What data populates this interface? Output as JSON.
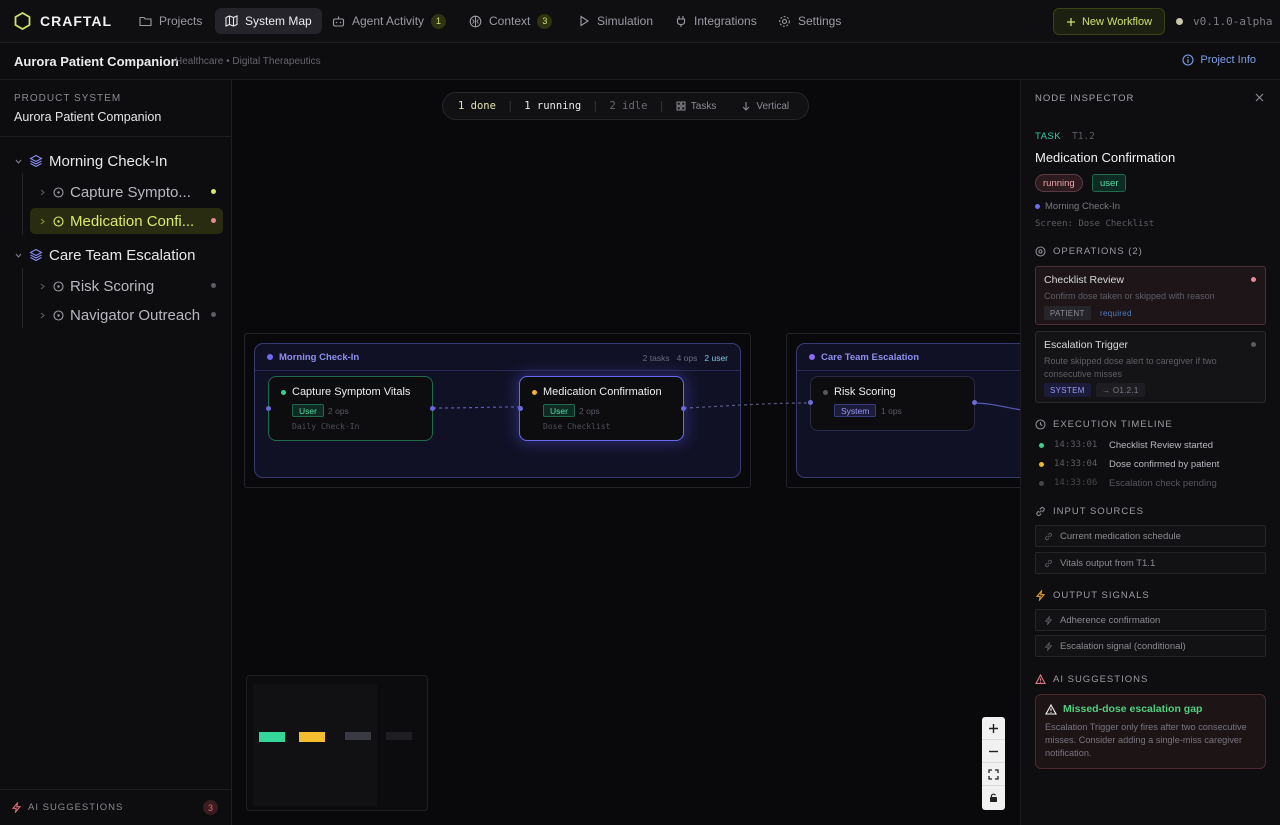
{
  "app": {
    "logo_text": "CRAFTAL",
    "version": "v0.1.0-alpha",
    "new_workflow_label": "New Workflow"
  },
  "nav": [
    {
      "label": "Projects",
      "icon": "folder-icon"
    },
    {
      "label": "System Map",
      "icon": "map-icon",
      "active": true
    },
    {
      "label": "Agent Activity",
      "icon": "robot-icon",
      "badge": "1"
    },
    {
      "label": "Context",
      "icon": "brain-icon",
      "badge": "3"
    },
    {
      "label": "Simulation",
      "icon": "play-icon"
    },
    {
      "label": "Integrations",
      "icon": "plug-icon"
    },
    {
      "label": "Settings",
      "icon": "gear-icon"
    }
  ],
  "project": {
    "title": "Aurora Patient Companion",
    "meta": "Healthcare • Digital Therapeutics",
    "info_label": "Project Info"
  },
  "sidebar": {
    "label": "PRODUCT SYSTEM",
    "system_name": "Aurora Patient Companion",
    "groups": [
      {
        "label": "Morning Check-In",
        "tasks": [
          {
            "label": "Capture Sympto...",
            "status_color": "#d9e870"
          },
          {
            "label": "Medication Confi...",
            "status_color": "#e58a96",
            "selected": true
          }
        ]
      },
      {
        "label": "Care Team Escalation",
        "tasks": [
          {
            "label": "Risk Scoring",
            "status_color": "#5c5c64"
          },
          {
            "label": "Navigator Outreach",
            "status_color": "#5c5c64"
          }
        ]
      }
    ],
    "bottom_label": "AI SUGGESTIONS",
    "bottom_count": "3"
  },
  "canvas": {
    "status": {
      "done": "1 done",
      "running": "1 running",
      "idle": "2 idle"
    },
    "tasks_label": "Tasks",
    "layout_label": "Vertical",
    "groups": [
      {
        "title": "Morning Check-In",
        "tasks": "2 tasks",
        "ops": "4 ops",
        "users": "2 user"
      },
      {
        "title": "Care Team Escalation"
      }
    ],
    "nodes": [
      {
        "title": "Capture Symptom Vitals",
        "tag": "User",
        "ops": "2 ops",
        "screen": "Daily Check-In",
        "dot": "#3ecf8e"
      },
      {
        "title": "Medication Confirmation",
        "tag": "User",
        "ops": "2 ops",
        "screen": "Dose Checklist",
        "dot": "#f0b429"
      },
      {
        "title": "Risk Scoring",
        "tag": "System",
        "ops": "1 ops",
        "dot": "#55555d"
      }
    ],
    "minimap_colors": [
      "#35d69a",
      "#f5be2e",
      "#3a3a42",
      "#1e1e22"
    ]
  },
  "inspector": {
    "header": "NODE INSPECTOR",
    "type": "TASK",
    "id": "T1.2",
    "title": "Medication Confirmation",
    "status_pill": "running",
    "role_pill": "user",
    "group": "Morning Check-In",
    "screen": "Screen: Dose Checklist",
    "operations_header": "OPERATIONS (2)",
    "operations": [
      {
        "title": "Checklist Review",
        "desc": "Confirm dose taken or skipped with reason",
        "tag": "PATIENT",
        "extra": "required",
        "dot": "#e58a96"
      },
      {
        "title": "Escalation Trigger",
        "desc": "Route skipped dose alert to caregiver if two consecutive misses",
        "tag": "SYSTEM",
        "extra": "→ O1.2.1",
        "dot": "#5c5c64"
      }
    ],
    "timeline_header": "EXECUTION TIMELINE",
    "timeline": [
      {
        "time": "14:33:01",
        "text": "Checklist Review started",
        "dot": "#3ecf8e"
      },
      {
        "time": "14:33:04",
        "text": "Dose confirmed by patient",
        "dot": "#f0b429"
      },
      {
        "time": "14:33:06",
        "text": "Escalation check pending",
        "dot": "#44444b"
      }
    ],
    "inputs_header": "INPUT SOURCES",
    "inputs": [
      "Current medication schedule",
      "Vitals output from T1.1"
    ],
    "outputs_header": "OUTPUT SIGNALS",
    "outputs": [
      "Adherence confirmation",
      "Escalation signal (conditional)"
    ],
    "suggestions_header": "AI SUGGESTIONS",
    "suggestion": {
      "title": "Missed-dose escalation gap",
      "body": "Escalation Trigger only fires after two consecutive misses. Consider adding a single-miss caregiver notification."
    }
  }
}
